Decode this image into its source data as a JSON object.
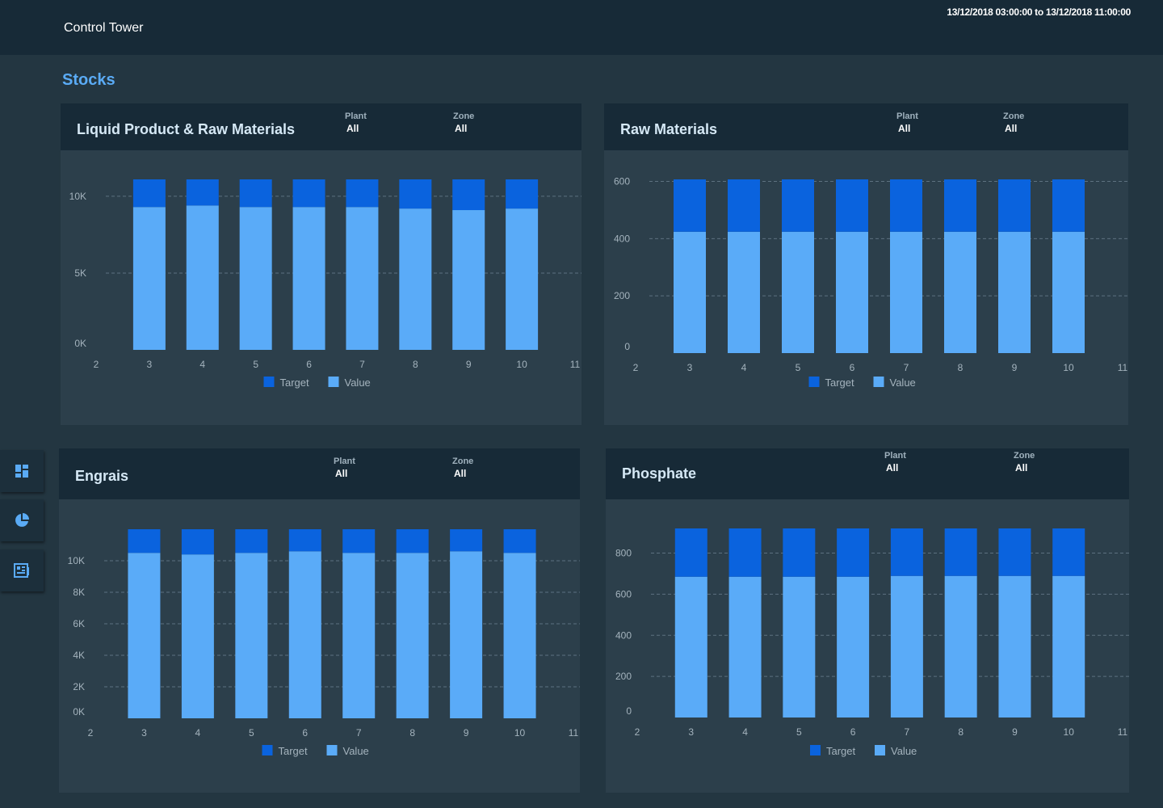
{
  "header": {
    "app_title": "Control Tower",
    "date_range": "13/12/2018 03:00:00 to 13/12/2018 11:00:00"
  },
  "section_title": "Stocks",
  "sidebar": {
    "items": [
      {
        "icon": "dashboard-icon"
      },
      {
        "icon": "pie-chart-icon"
      },
      {
        "icon": "report-icon"
      }
    ]
  },
  "colors": {
    "target": "#0a63de",
    "value": "#5aabf8",
    "accent": "#5aabf5"
  },
  "panels": [
    {
      "title": "Liquid Product & Raw Materials",
      "filters": [
        {
          "label": "Plant",
          "value": "All"
        },
        {
          "label": "Zone",
          "value": "All"
        }
      ]
    },
    {
      "title": "Raw Materials",
      "filters": [
        {
          "label": "Plant",
          "value": "All"
        },
        {
          "label": "Zone",
          "value": "All"
        }
      ]
    },
    {
      "title": "Engrais",
      "filters": [
        {
          "label": "Plant",
          "value": "All"
        },
        {
          "label": "Zone",
          "value": "All"
        }
      ]
    },
    {
      "title": "Phosphate",
      "filters": [
        {
          "label": "Plant",
          "value": "All"
        },
        {
          "label": "Zone",
          "value": "All"
        }
      ]
    }
  ],
  "chart_data": [
    {
      "type": "bar",
      "stacked": true,
      "title": "Liquid Product & Raw Materials",
      "x_ticks": [
        "2",
        "3",
        "4",
        "5",
        "6",
        "7",
        "8",
        "9",
        "10",
        "11"
      ],
      "categories": [
        "3",
        "4",
        "5",
        "6",
        "7",
        "8",
        "9",
        "10"
      ],
      "series": [
        {
          "name": "Target",
          "values": [
            1800,
            1700,
            1800,
            1800,
            1800,
            1900,
            2000,
            1900
          ]
        },
        {
          "name": "Value",
          "values": [
            9300,
            9400,
            9300,
            9300,
            9300,
            9200,
            9100,
            9200
          ]
        }
      ],
      "y_ticks": [
        {
          "v": 0,
          "label": "0K"
        },
        {
          "v": 5000,
          "label": "5K"
        },
        {
          "v": 10000,
          "label": "10K"
        }
      ],
      "ylim": [
        0,
        11100
      ],
      "grid": true,
      "legend": "bottom"
    },
    {
      "type": "bar",
      "stacked": true,
      "title": "Raw Materials",
      "x_ticks": [
        "2",
        "3",
        "4",
        "5",
        "6",
        "7",
        "8",
        "9",
        "10",
        "11"
      ],
      "categories": [
        "3",
        "4",
        "5",
        "6",
        "7",
        "8",
        "9",
        "10"
      ],
      "series": [
        {
          "name": "Target",
          "values": [
            183,
            183,
            183,
            183,
            183,
            183,
            183,
            183
          ]
        },
        {
          "name": "Value",
          "values": [
            424,
            424,
            424,
            424,
            424,
            424,
            424,
            424
          ]
        }
      ],
      "y_ticks": [
        {
          "v": 0,
          "label": "0"
        },
        {
          "v": 200,
          "label": "200"
        },
        {
          "v": 400,
          "label": "400"
        },
        {
          "v": 600,
          "label": "600"
        }
      ],
      "ylim": [
        0,
        607
      ],
      "grid": true,
      "legend": "bottom"
    },
    {
      "type": "bar",
      "stacked": true,
      "title": "Engrais",
      "x_ticks": [
        "2",
        "3",
        "4",
        "5",
        "6",
        "7",
        "8",
        "9",
        "10",
        "11"
      ],
      "categories": [
        "3",
        "4",
        "5",
        "6",
        "7",
        "8",
        "9",
        "10"
      ],
      "series": [
        {
          "name": "Target",
          "values": [
            1500,
            1600,
            1500,
            1400,
            1500,
            1500,
            1400,
            1500
          ]
        },
        {
          "name": "Value",
          "values": [
            10500,
            10400,
            10500,
            10600,
            10500,
            10500,
            10600,
            10500
          ]
        }
      ],
      "y_ticks": [
        {
          "v": 0,
          "label": "0K"
        },
        {
          "v": 2000,
          "label": "2K"
        },
        {
          "v": 4000,
          "label": "4K"
        },
        {
          "v": 6000,
          "label": "6K"
        },
        {
          "v": 8000,
          "label": "8K"
        },
        {
          "v": 10000,
          "label": "10K"
        }
      ],
      "ylim": [
        0,
        12000
      ],
      "grid": true,
      "legend": "bottom"
    },
    {
      "type": "bar",
      "stacked": true,
      "title": "Phosphate",
      "x_ticks": [
        "2",
        "3",
        "4",
        "5",
        "6",
        "7",
        "8",
        "9",
        "10",
        "11"
      ],
      "categories": [
        "3",
        "4",
        "5",
        "6",
        "7",
        "8",
        "9",
        "10"
      ],
      "series": [
        {
          "name": "Target",
          "values": [
            235,
            235,
            235,
            235,
            231,
            231,
            231,
            231
          ]
        },
        {
          "name": "Value",
          "values": [
            685,
            685,
            685,
            685,
            689,
            689,
            689,
            689
          ]
        }
      ],
      "y_ticks": [
        {
          "v": 0,
          "label": "0"
        },
        {
          "v": 200,
          "label": "200"
        },
        {
          "v": 400,
          "label": "400"
        },
        {
          "v": 600,
          "label": "600"
        },
        {
          "v": 800,
          "label": "800"
        }
      ],
      "ylim": [
        0,
        920
      ],
      "grid": true,
      "legend": "bottom"
    }
  ]
}
